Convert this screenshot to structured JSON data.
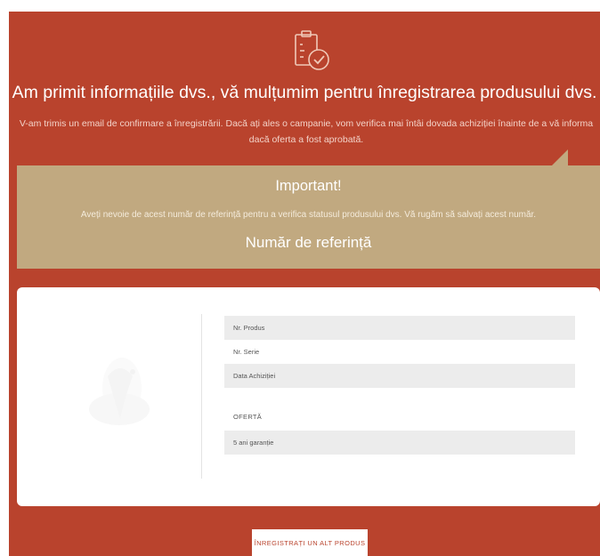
{
  "hero": {
    "icon": "clipboard-check-icon",
    "title": "Am primit informațiile dvs., vă mulțumim pentru înregistrarea produsului dvs.",
    "subtitle": "V-am trimis un email de confirmare a înregistrării. Dacă ați ales o campanie, vom verifica mai întâi dovada achiziției înainte de a vă informa dacă oferta a fost aprobată."
  },
  "important": {
    "title": "Important!",
    "text": "Aveți nevoie de acest număr de referință pentru a verifica statusul produsului dvs. Vă rugăm să salvați acest număr.",
    "reference_label": "Număr de referință"
  },
  "product": {
    "product_number_label": "Nr. Produs",
    "serial_label": "Nr. Serie",
    "purchase_date_label": "Data Achiziției",
    "offer_label": "OFERTĂ",
    "offer_value": "5 ani garanție"
  },
  "cta": {
    "label": "ÎNREGISTRAȚI UN ALT PRODUS"
  },
  "colors": {
    "page_background": "#b9432d",
    "important_background": "#c1a980",
    "card_background": "#ffffff",
    "field_background": "#ececec"
  }
}
